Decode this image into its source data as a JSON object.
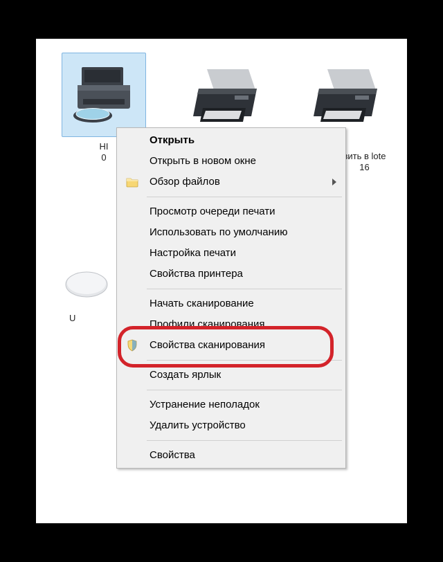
{
  "devices": {
    "selected_label": "HI\n0",
    "partial_label": "вить в\nlote 16",
    "u_label": "U"
  },
  "context_menu": {
    "open": "Открыть",
    "open_new": "Открыть в новом окне",
    "browse_files": "Обзор файлов",
    "print_queue": "Просмотр очереди печати",
    "set_default": "Использовать по умолчанию",
    "print_setup": "Настройка печати",
    "printer_props": "Свойства принтера",
    "start_scan": "Начать сканирование",
    "scan_profiles": "Профили сканирования...",
    "scan_props": "Свойства сканирования",
    "create_shortcut": "Создать ярлык",
    "troubleshoot": "Устранение неполадок",
    "remove_device": "Удалить устройство",
    "properties": "Свойства"
  },
  "highlight_target": "start_scan"
}
